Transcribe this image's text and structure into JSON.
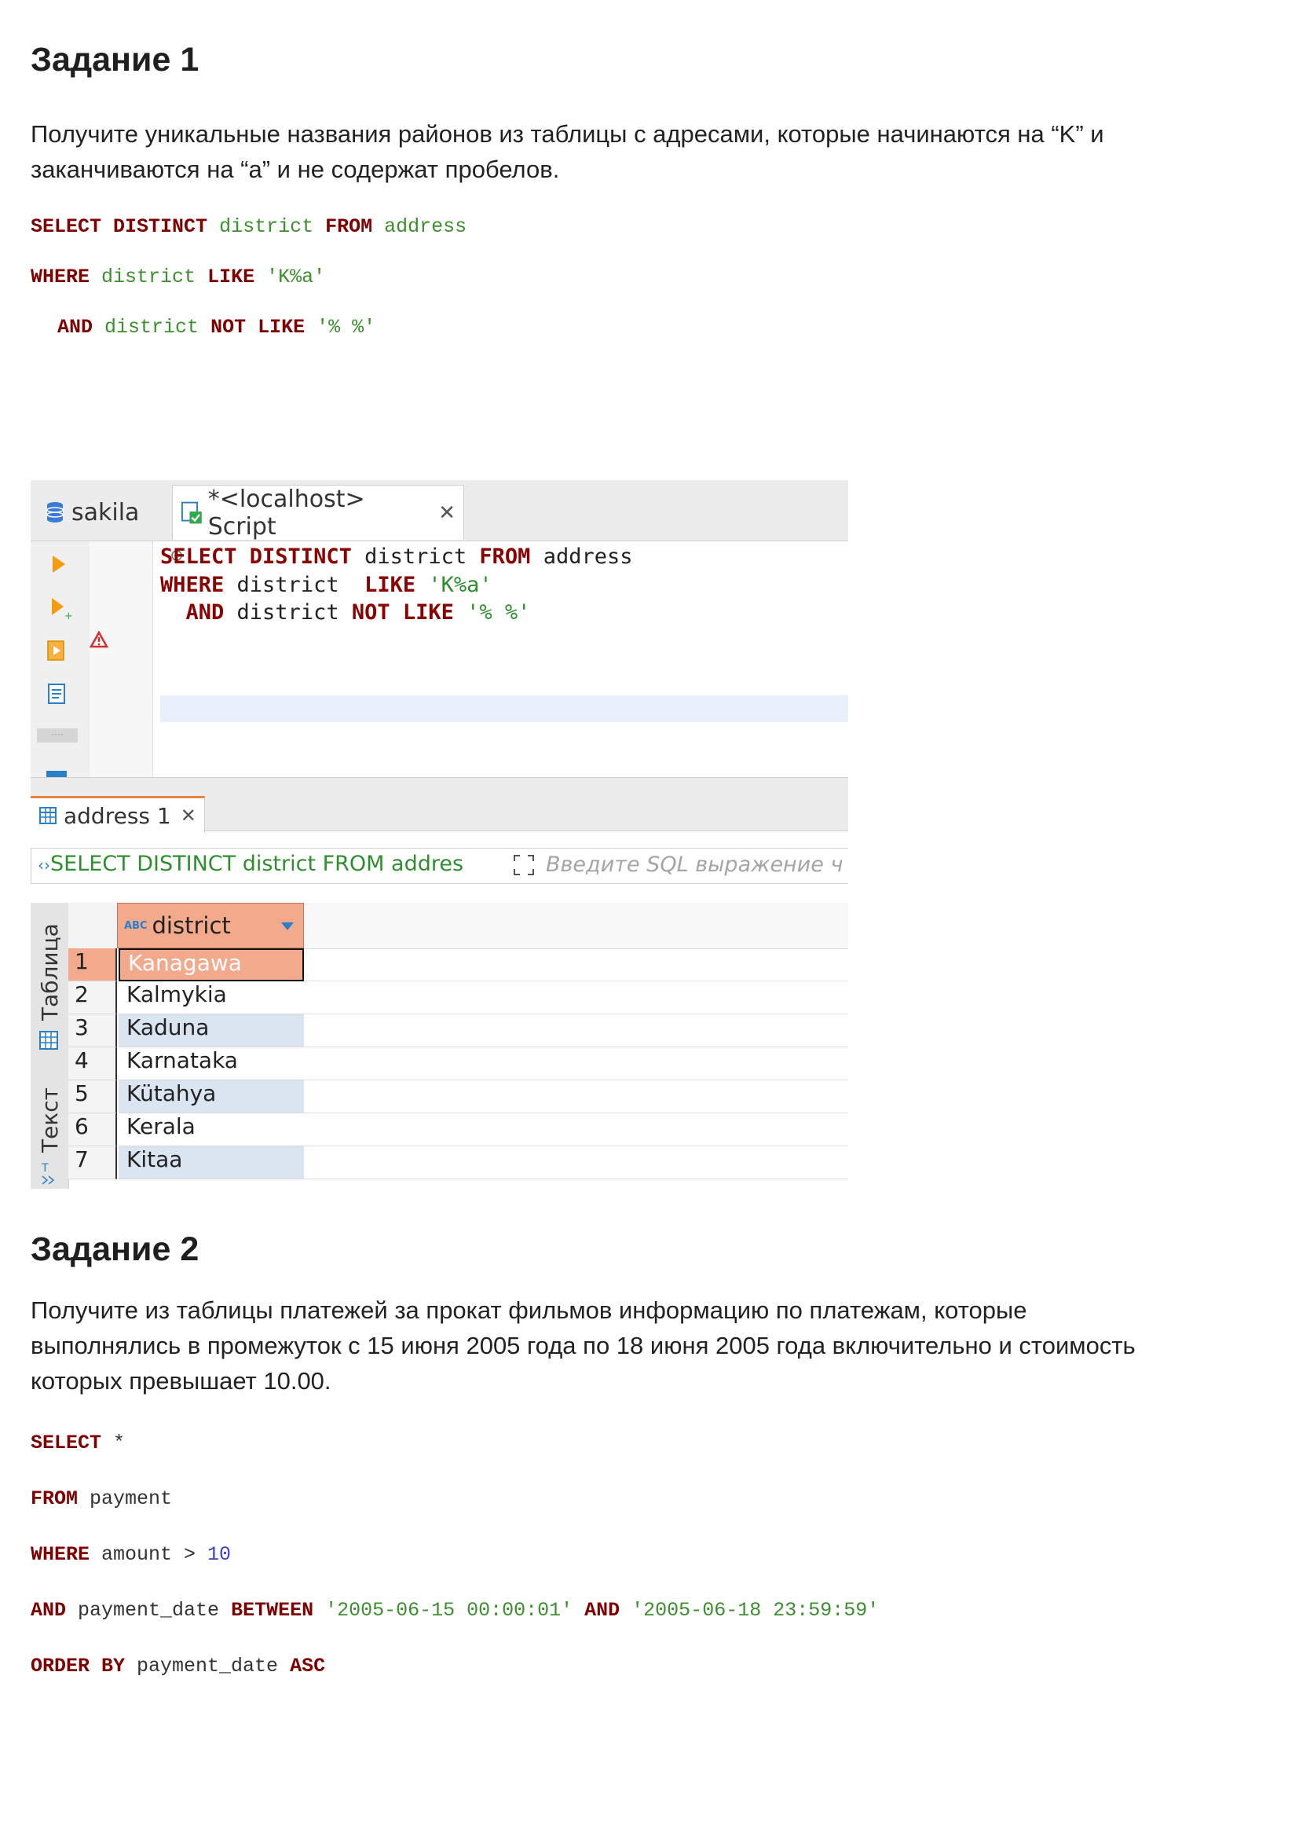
{
  "task1": {
    "heading": "Задание 1",
    "description_line1": "Получите уникальные названия районов из таблицы с адресами, которые начинаются на “K” и",
    "description_line2": "заканчиваются на “a” и не содержат пробелов.",
    "code": {
      "l1_kw1": "SELECT DISTINCT",
      "l1_id1": "district",
      "l1_kw2": "FROM",
      "l1_id2": "address",
      "l2_kw1": "WHERE",
      "l2_id1": "district",
      "l2_kw2": "LIKE",
      "l2_str": "'K%a'",
      "l3_kw1": "AND",
      "l3_id1": "district",
      "l3_kw2": "NOT LIKE",
      "l3_str": "'% %'"
    }
  },
  "screenshot": {
    "tabs": [
      {
        "icon": "database-icon",
        "label": "sakila"
      },
      {
        "icon": "script-icon",
        "label": "*<localhost> Script",
        "close": "✕"
      }
    ],
    "editor": {
      "l1_kw1": "SELECT DISTINCT",
      "l1_rest1": " district ",
      "l1_kw2": "FROM",
      "l1_rest2": " address",
      "l2_kw1": "WHERE",
      "l2_rest1": " district  ",
      "l2_kw2": "LIKE",
      "l2_str": " 'K%a'",
      "l3_kw1": "  AND",
      "l3_rest1": " district ",
      "l3_kw2": "NOT LIKE",
      "l3_str": " '% %'"
    },
    "result_tab": {
      "label": "address 1",
      "close": "✕"
    },
    "filter": {
      "query": "SELECT DISTINCT district FROM addres",
      "placeholder": "Введите SQL выражение ч"
    },
    "side_tabs": {
      "table": "Таблица",
      "text": "Текст"
    },
    "grid": {
      "column_header": "district",
      "type_badge": "ABC",
      "rows": [
        {
          "n": "1",
          "value": "Kanagawa"
        },
        {
          "n": "2",
          "value": "Kalmykia"
        },
        {
          "n": "3",
          "value": "Kaduna"
        },
        {
          "n": "4",
          "value": "Karnataka"
        },
        {
          "n": "5",
          "value": "Kütahya"
        },
        {
          "n": "6",
          "value": "Kerala"
        },
        {
          "n": "7",
          "value": "Kitaa"
        }
      ]
    },
    "colors": {
      "selected_row": "#f2a98c",
      "alt_row": "#dbe5f1",
      "header": "#f2a98c"
    }
  },
  "task2": {
    "heading": "Задание 2",
    "description_line1": "Получите из таблицы платежей за прокат фильмов информацию по платежам, которые",
    "description_line2": "выполнялись в промежуток с 15 июня 2005 года по 18 июня 2005 года включительно и стоимость",
    "description_line3": "которых превышает 10.00.",
    "code": {
      "l1_kw": "SELECT",
      "l1_rest": " *",
      "l2_kw": "FROM",
      "l2_rest": " payment",
      "l3_kw": "WHERE",
      "l3_rest": " amount > ",
      "l3_num": "10",
      "l4_kw1": "AND",
      "l4_rest": " payment_date ",
      "l4_kw2": "BETWEEN",
      "l4_str1": " '2005-06-15 00:00:01' ",
      "l4_kw3": "AND",
      "l4_str2": " '2005-06-18 23:59:59'",
      "l5_kw": "ORDER BY",
      "l5_rest": " payment_date ",
      "l5_kw2": "ASC"
    }
  }
}
